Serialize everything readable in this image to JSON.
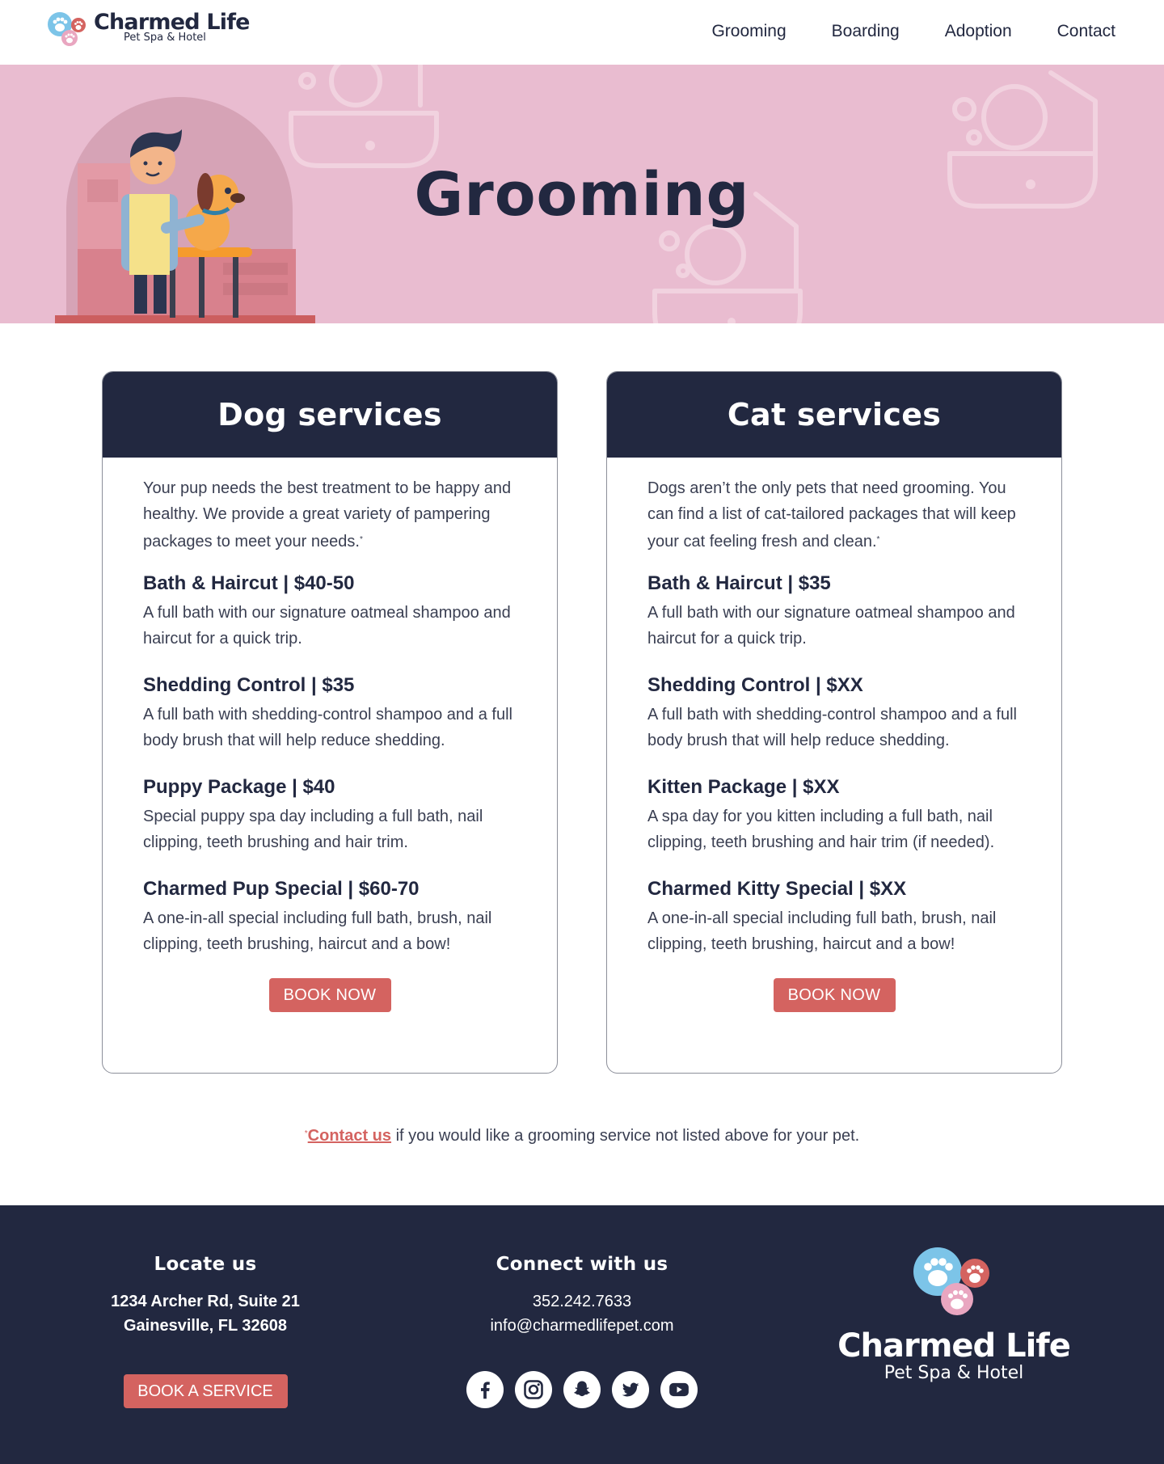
{
  "brand": {
    "name": "Charmed Life",
    "tagline": "Pet Spa & Hotel"
  },
  "nav": [
    "Grooming",
    "Boarding",
    "Adoption",
    "Contact"
  ],
  "hero": {
    "title": "Grooming"
  },
  "dog": {
    "heading": "Dog services",
    "intro": "Your pup needs the best treatment to be happy and healthy. We provide a great variety of pampering packages to meet your needs.",
    "intro_mark": "*",
    "services": [
      {
        "title": "Bath & Haircut  |  $40-50",
        "desc": "A full bath with our signature oatmeal shampoo and haircut for a quick trip."
      },
      {
        "title": "Shedding Control  |  $35",
        "desc": "A full bath with shedding-control shampoo and a full body brush that will help reduce shedding."
      },
      {
        "title": "Puppy Package  |  $40",
        "desc": "Special puppy spa day including a full bath, nail clipping, teeth brushing and hair trim."
      },
      {
        "title": "Charmed Pup Special  |  $60-70",
        "desc": "A one-in-all special including full bath, brush, nail clipping, teeth brushing, haircut and a bow!"
      }
    ],
    "button": "BOOK NOW"
  },
  "cat": {
    "heading": "Cat services",
    "intro": "Dogs aren’t the only pets that need grooming. You can find a list of cat-tailored packages that will keep your cat feeling fresh and clean.",
    "intro_mark": "*",
    "services": [
      {
        "title": "Bath & Haircut  |  $35",
        "desc": "A full bath with our signature oatmeal shampoo and haircut for a quick trip."
      },
      {
        "title": "Shedding Control  |  $XX",
        "desc": "A full bath with shedding-control shampoo and a full body brush that will help reduce shedding."
      },
      {
        "title": "Kitten Package  |  $XX",
        "desc": "A spa day for you kitten including a full bath, nail clipping, teeth brushing and hair trim (if needed)."
      },
      {
        "title": "Charmed Kitty Special  |  $XX",
        "desc": "A one-in-all special including full bath, brush, nail clipping, teeth brushing, haircut and a bow!"
      }
    ],
    "button": "BOOK NOW"
  },
  "note": {
    "mark": "*",
    "link": "Contact us",
    "text": " if you would like a grooming service not listed above for your pet."
  },
  "footer": {
    "locate": {
      "heading": "Locate us",
      "line1": "1234 Archer Rd, Suite 21",
      "line2": "Gainesville, FL 32608",
      "button": "BOOK A SERVICE"
    },
    "connect": {
      "heading": "Connect with us",
      "phone": "352.242.7633",
      "email": "info@charmedlifepet.com"
    },
    "socials": [
      "facebook-icon",
      "instagram-icon",
      "snapchat-icon",
      "twitter-icon",
      "youtube-icon"
    ]
  },
  "colors": {
    "navy": "#222840",
    "pink": "#e9bcd0",
    "coral": "#d46360",
    "blue": "#7cc4e8"
  }
}
